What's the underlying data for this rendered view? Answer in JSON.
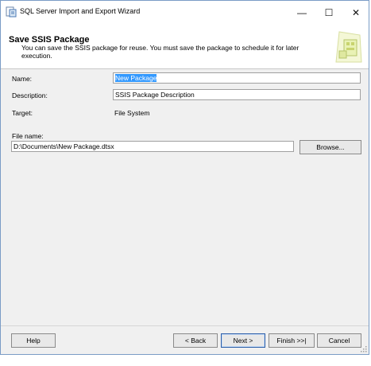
{
  "window": {
    "title": "SQL Server Import and Export Wizard",
    "controls": {
      "minimize": "—",
      "maximize": "☐",
      "close": "✕"
    }
  },
  "header": {
    "title": "Save SSIS Package",
    "description": "You can save the SSIS package for reuse. You must save the package to schedule it for later execution."
  },
  "form": {
    "name_label": "Name:",
    "name_value": "New Package",
    "description_label": "Description:",
    "description_value": "SSIS Package Description",
    "target_label": "Target:",
    "target_value": "File System",
    "filename_label": "File name:",
    "filename_value": "D:\\Documents\\New Package.dtsx",
    "browse_label": "Browse..."
  },
  "footer": {
    "help": "Help",
    "back": "< Back",
    "next": "Next >",
    "finish": "Finish >>|",
    "cancel": "Cancel"
  },
  "colors": {
    "selection": "#3399ff",
    "window_bg": "#f0f0f0",
    "default_button_border": "#2b5ea8"
  },
  "icons": [
    "app-wizard-icon",
    "minimize-icon",
    "maximize-icon",
    "close-icon",
    "wizard-graphic-icon",
    "resize-grip-icon"
  ]
}
